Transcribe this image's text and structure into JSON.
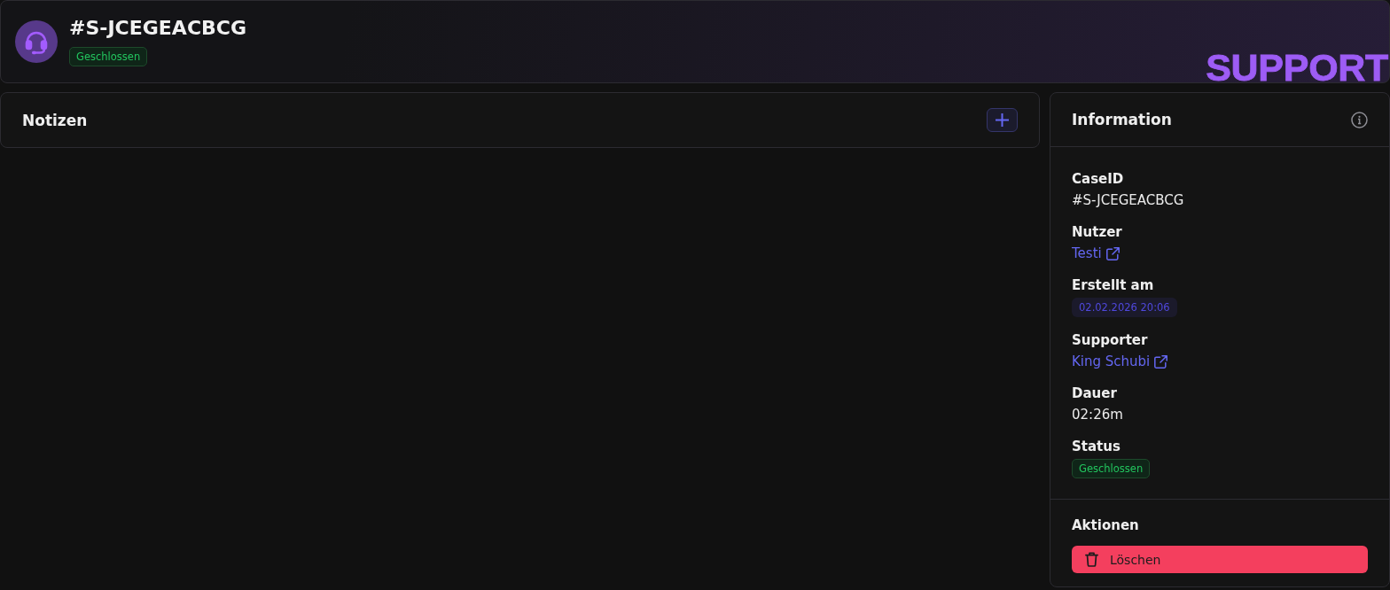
{
  "header": {
    "title": "#S-JCEGEACBCG",
    "status": "Geschlossen",
    "brand": "SUPPORT"
  },
  "notes": {
    "title": "Notizen"
  },
  "information": {
    "title": "Information",
    "fields": [
      {
        "label": "CaseID",
        "value": "#S-JCEGEACBCG",
        "kind": "text"
      },
      {
        "label": "Nutzer",
        "value": "Testi",
        "kind": "link"
      },
      {
        "label": "Erstellt am",
        "value": "02.02.2026 20:06",
        "kind": "date"
      },
      {
        "label": "Supporter",
        "value": "King Schubi",
        "kind": "link"
      },
      {
        "label": "Dauer",
        "value": "02:26m",
        "kind": "text"
      },
      {
        "label": "Status",
        "value": "Geschlossen",
        "kind": "status"
      }
    ]
  },
  "actions": {
    "title": "Aktionen",
    "buttons": [
      {
        "label": "Löschen",
        "kind": "danger"
      }
    ]
  }
}
